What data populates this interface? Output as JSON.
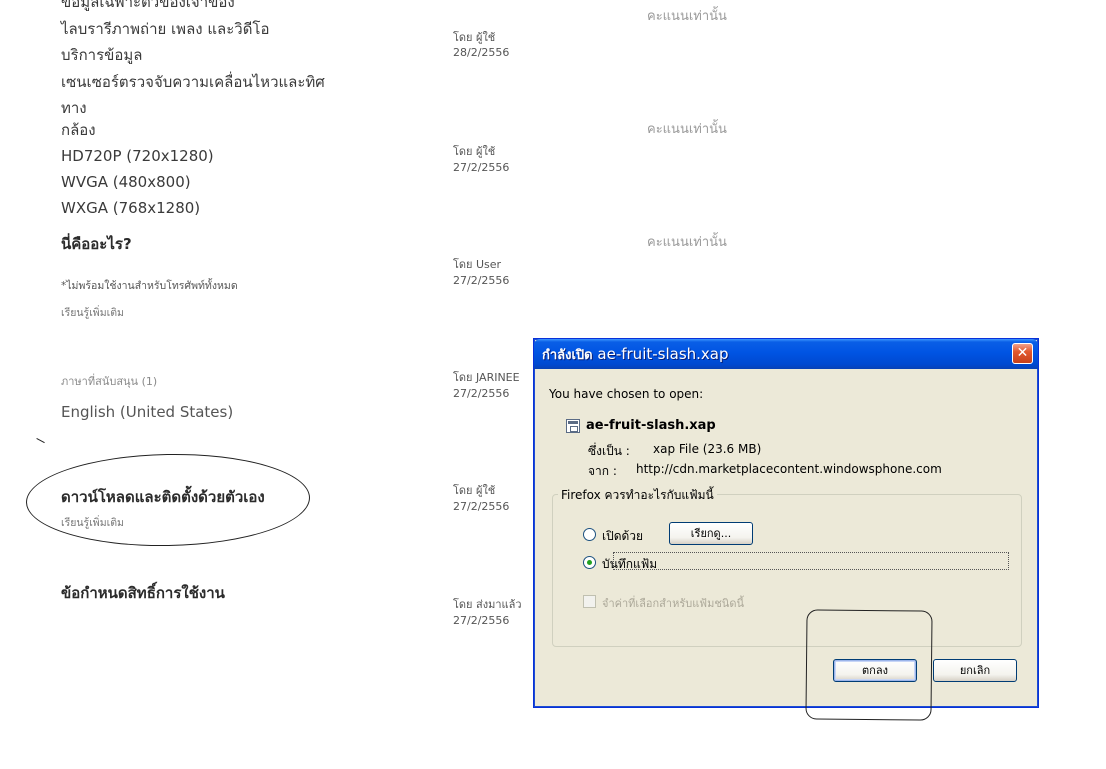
{
  "specs": {
    "lines": [
      "ข้อมูลเฉพาะตัวของเจ้าของ",
      "ไลบรารีภาพถ่าย เพลง และวิดีโอ",
      "บริการข้อมูล",
      "เซนเซอร์ตรวจจับความเคลื่อนไหวและทิศ",
      "ทาง",
      "กล้อง",
      "HD720P (720x1280)",
      "WVGA (480x800)",
      "WXGA (768x1280)"
    ]
  },
  "whatsthis": {
    "heading": "นี่คืออะไร?",
    "note": "*ไม่พร้อมใช้งานสำหรับโทรศัพท์ทั้งหมด",
    "learn_more": "เรียนรู้เพิ่มเติม"
  },
  "languages": {
    "label": "ภาษาที่สนับสนุน (1)",
    "value": "English (United States)"
  },
  "download": {
    "heading": "ดาวน์โหลดและติดตั้งด้วยตัวเอง",
    "learn_more": "เรียนรู้เพิ่มเติม"
  },
  "license": {
    "heading": "ข้อกำหนดสิทธิ์การใช้งาน"
  },
  "reviews": [
    {
      "score_text": "คะแนนเท่านั้น",
      "by": "โดย ผู้ใช้",
      "date": "28/2/2556"
    },
    {
      "score_text": "คะแนนเท่านั้น",
      "by": "โดย ผู้ใช้",
      "date": "27/2/2556"
    },
    {
      "score_text": "คะแนนเท่านั้น",
      "by": "โดย User",
      "date": "27/2/2556"
    },
    {
      "by": "โดย JARINEE",
      "date": "27/2/2556"
    },
    {
      "by": "โดย ผู้ใช้",
      "date": "27/2/2556"
    },
    {
      "by": "โดย ส่งมาแล้ว",
      "date": "27/2/2556"
    }
  ],
  "dialog": {
    "title_prefix": "กำลังเปิด",
    "title_file": "ae-fruit-slash.xap",
    "close_glyph": "✕",
    "chosen_text": "You have chosen to open:",
    "file_name": "ae-fruit-slash.xap",
    "type_label": "ซึ่งเป็น :",
    "type_value": "xap File (23.6 MB)",
    "from_label": "จาก :",
    "from_value": "http://cdn.marketplacecontent.windowsphone.com",
    "group_title": "Firefox ควรทำอะไรกับแฟ้มนี้",
    "open_with_label": "เปิดด้วย",
    "browse_button": "เรียกดู...",
    "save_file_label": "บันทึกแฟ้ม",
    "remember_label": "จำค่าที่เลือกสำหรับแฟ้มชนิดนี้",
    "ok_button": "ตกลง",
    "cancel_button": "ยกเลิก"
  }
}
